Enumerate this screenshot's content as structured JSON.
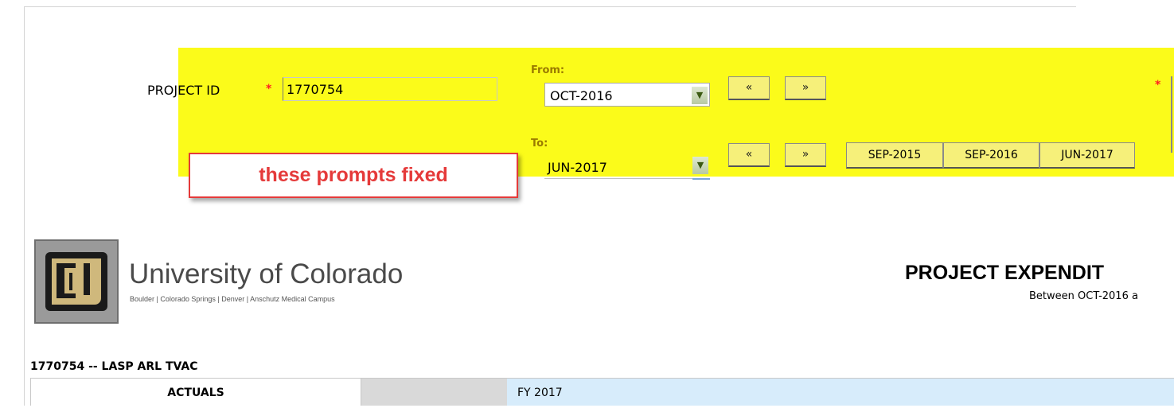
{
  "prompts": {
    "project_id_label": "PROJECT ID",
    "required_marker": "*",
    "project_id_value": "1770754",
    "from_label": "From:",
    "from_value": "OCT-2016",
    "to_label": "To:",
    "to_value": "JUN-2017",
    "prev_glyph": "«",
    "next_glyph": "»",
    "period_buttons": [
      "SEP-2015",
      "SEP-2016",
      "JUN-2017"
    ]
  },
  "callout": {
    "text": "these prompts fixed"
  },
  "branding": {
    "university_name": "University of Colorado",
    "campuses": "Boulder | Colorado Springs | Denver | Anschutz Medical Campus"
  },
  "report": {
    "title": "PROJECT EXPENDIT",
    "subtitle": "Between OCT-2016 a"
  },
  "table": {
    "heading": "1770754 -- LASP ARL TVAC",
    "col_actuals": "ACTUALS",
    "col_fy": "FY 2017"
  },
  "colors": {
    "highlight": "#fbfb1a",
    "callout": "#e53a3a",
    "fy_header": "#d7ecfb"
  }
}
